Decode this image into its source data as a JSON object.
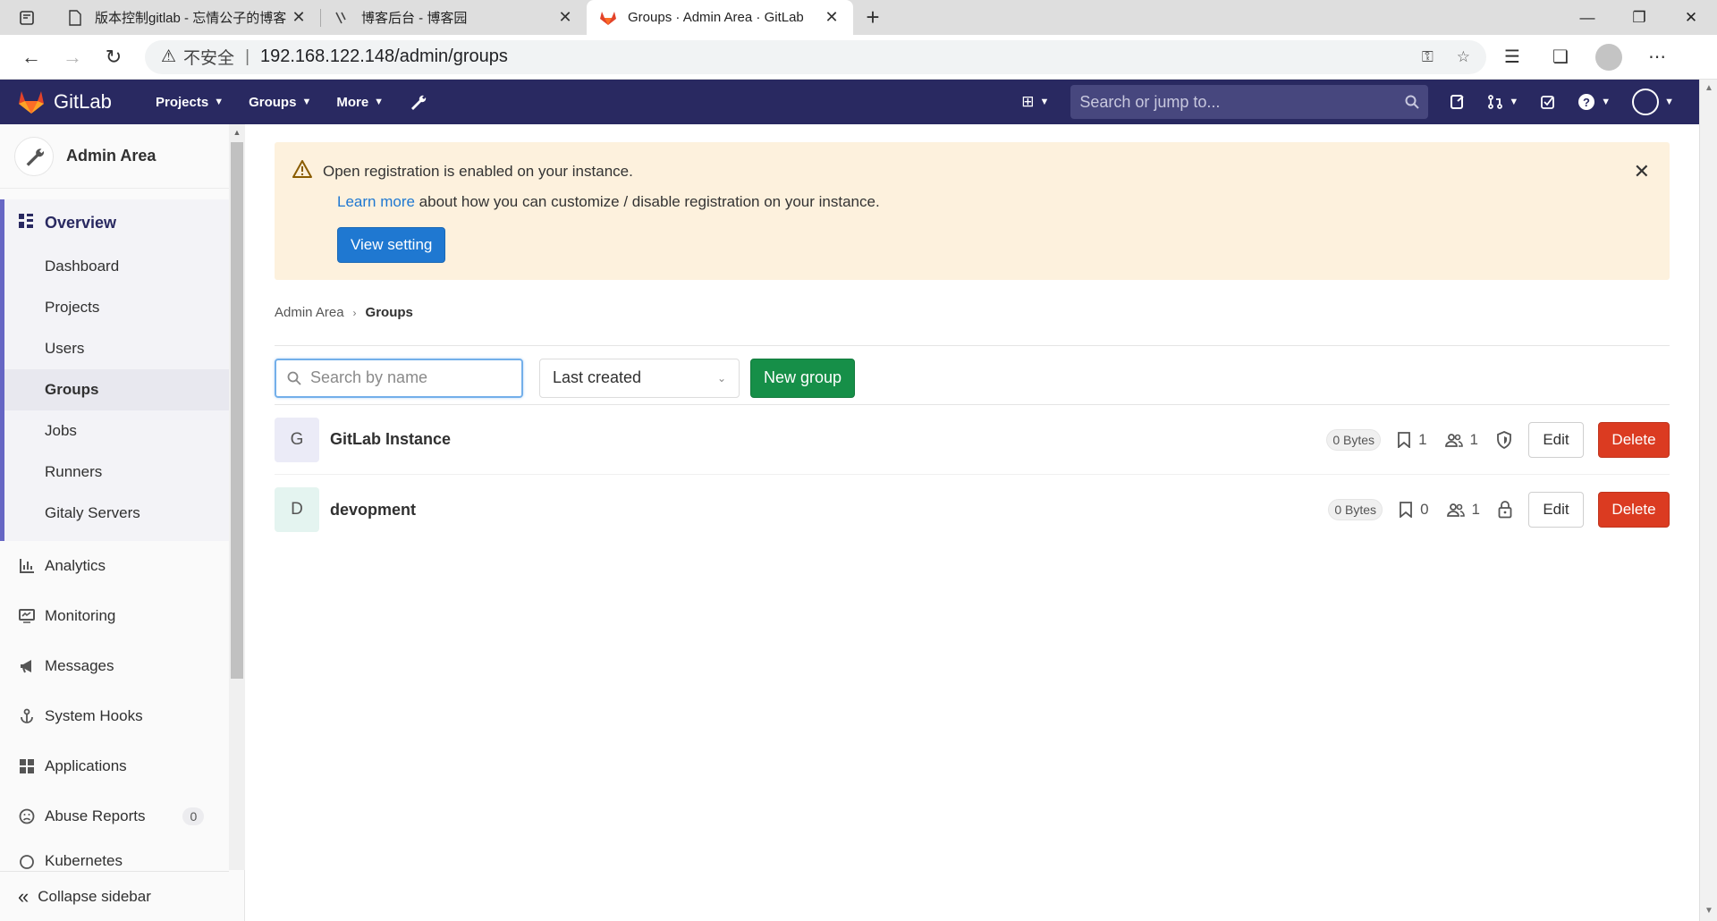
{
  "browser": {
    "tabs": [
      {
        "title": "版本控制gitlab - 忘情公子的博客",
        "icon": "document-icon"
      },
      {
        "title": "博客后台 - 博客园",
        "icon": "cnblogs-icon"
      },
      {
        "title": "Groups · Admin Area · GitLab",
        "icon": "gitlab-icon"
      }
    ],
    "insecure_label": "不安全",
    "url": "192.168.122.148/admin/groups"
  },
  "header": {
    "brand": "GitLab",
    "nav": {
      "projects": "Projects",
      "groups": "Groups",
      "more": "More"
    },
    "search_placeholder": "Search or jump to..."
  },
  "sidebar": {
    "title": "Admin Area",
    "overview": "Overview",
    "overview_items": [
      "Dashboard",
      "Projects",
      "Users",
      "Groups",
      "Jobs",
      "Runners",
      "Gitaly Servers"
    ],
    "selected_item": "Groups",
    "items": [
      {
        "label": "Analytics",
        "icon": "analytics-icon"
      },
      {
        "label": "Monitoring",
        "icon": "monitor-icon"
      },
      {
        "label": "Messages",
        "icon": "megaphone-icon"
      },
      {
        "label": "System Hooks",
        "icon": "hook-icon"
      },
      {
        "label": "Applications",
        "icon": "apps-icon"
      },
      {
        "label": "Abuse Reports",
        "icon": "abuse-icon",
        "badge": "0"
      },
      {
        "label": "Kubernetes",
        "icon": "kubernetes-icon"
      }
    ],
    "collapse": "Collapse sidebar"
  },
  "alert": {
    "title": "Open registration is enabled on your instance.",
    "link": "Learn more",
    "text": "about how you can customize / disable registration on your instance.",
    "button": "View setting"
  },
  "breadcrumb": {
    "parent": "Admin Area",
    "current": "Groups"
  },
  "toolbar": {
    "search_placeholder": "Search by name",
    "sort_value": "Last created",
    "new_group": "New group"
  },
  "groups": [
    {
      "initial": "G",
      "name": "GitLab Instance",
      "size": "0 Bytes",
      "projects": "1",
      "members": "1",
      "visibility": "internal-shield-icon",
      "avatar_bg": "#ebebf7",
      "edit": "Edit",
      "delete": "Delete"
    },
    {
      "initial": "D",
      "name": "devopment",
      "size": "0 Bytes",
      "projects": "0",
      "members": "1",
      "visibility": "private-lock-icon",
      "avatar_bg": "#e4f4f0",
      "edit": "Edit",
      "delete": "Delete"
    }
  ],
  "colors": {
    "header_bg": "#292961",
    "primary": "#1f78d1",
    "success": "#168f48",
    "danger": "#db3b21",
    "alert_bg": "#fdf1dd"
  }
}
